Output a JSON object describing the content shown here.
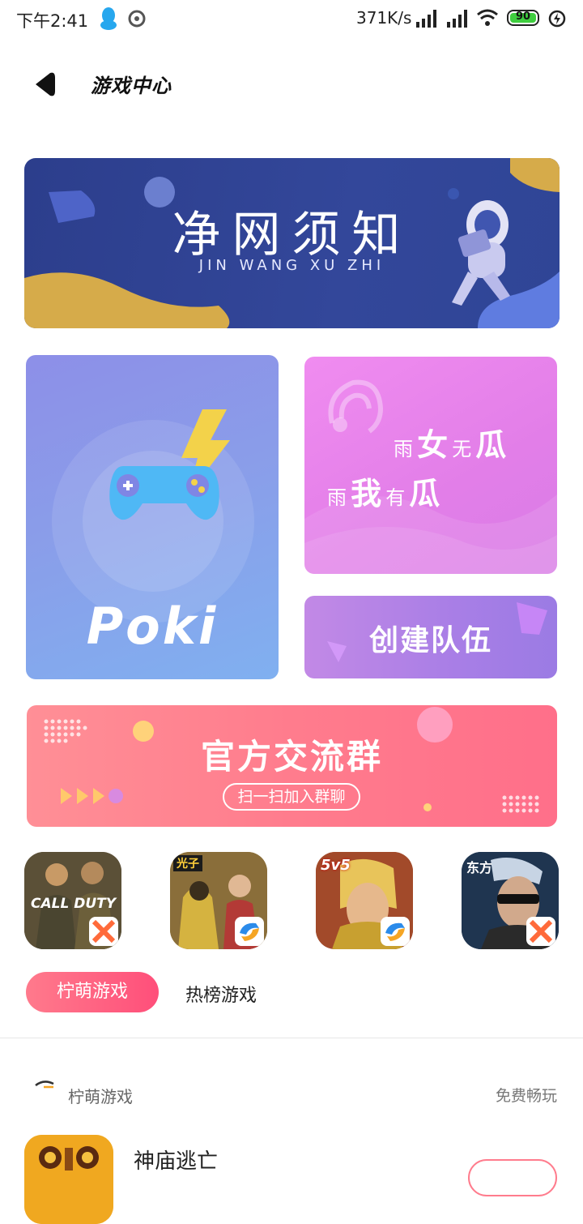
{
  "status_bar": {
    "time": "下午2:41",
    "speed": "371K/s",
    "battery": "90"
  },
  "header": {
    "title": "游戏中心"
  },
  "banner": {
    "title": "净网须知",
    "subtitle": "JIN WANG XU ZHI"
  },
  "cards": {
    "poki": "Poki",
    "melon": {
      "line1": [
        "雨",
        "女",
        "无",
        "瓜"
      ],
      "line2": [
        "雨",
        "我",
        "有",
        "瓜"
      ]
    },
    "team": "创建队伍",
    "group": {
      "title": "官方交流群",
      "button": "扫一扫加入群聊"
    }
  },
  "games": [
    {
      "name": "call-of-duty",
      "label": "CALL DUTY"
    },
    {
      "name": "peace-elite",
      "label": "光子"
    },
    {
      "name": "honor-of-kings",
      "label": "5v5"
    },
    {
      "name": "crossfire",
      "label": "东方"
    }
  ],
  "tabs": {
    "active": "柠萌游戏",
    "other": "热榜游戏"
  },
  "section": {
    "title": "柠萌游戏",
    "right": "免费畅玩"
  },
  "list": [
    {
      "name": "神庙逃亡"
    }
  ],
  "colors": {
    "accent_pink": "#ff5f82",
    "banner_blue": "#2f4596",
    "poki_blue": "#8a9de9",
    "melon_pink": "#e27ee8",
    "team_purple": "#a87ee6",
    "group_coral": "#ff7c8d"
  }
}
